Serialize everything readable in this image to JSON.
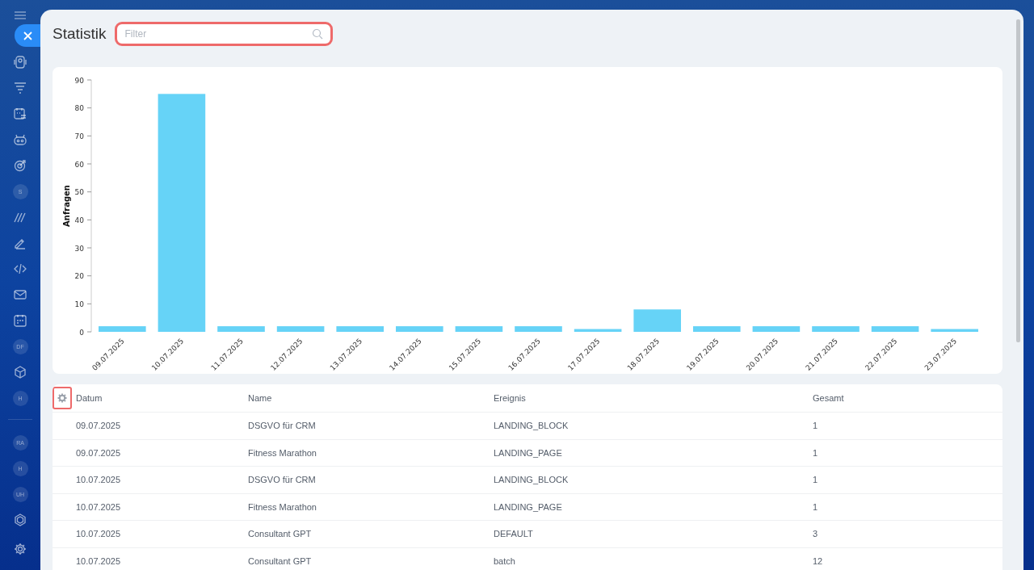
{
  "sidebar": {
    "items": [
      {
        "kind": "icon"
      },
      {
        "kind": "icon"
      },
      {
        "kind": "icon"
      },
      {
        "kind": "icon"
      },
      {
        "kind": "icon"
      },
      {
        "kind": "avatar",
        "label": "S"
      },
      {
        "kind": "icon"
      },
      {
        "kind": "icon"
      },
      {
        "kind": "icon"
      },
      {
        "kind": "icon"
      },
      {
        "kind": "icon"
      },
      {
        "kind": "avatar",
        "label": "DF"
      },
      {
        "kind": "icon"
      },
      {
        "kind": "avatar",
        "label": "H"
      },
      {
        "kind": "divider"
      },
      {
        "kind": "avatar",
        "label": "RA"
      },
      {
        "kind": "avatar",
        "label": "H"
      },
      {
        "kind": "avatar",
        "label": "UH"
      },
      {
        "kind": "icon"
      }
    ]
  },
  "page": {
    "title": "Statistik",
    "filter": {
      "placeholder": "Filter"
    }
  },
  "chart": {
    "chart_data": {
      "type": "bar",
      "ylabel": "Anfragen",
      "categories": [
        "09.07.2025",
        "10.07.2025",
        "11.07.2025",
        "12.07.2025",
        "13.07.2025",
        "14.07.2025",
        "15.07.2025",
        "16.07.2025",
        "17.07.2025",
        "18.07.2025",
        "19.07.2025",
        "20.07.2025",
        "21.07.2025",
        "22.07.2025",
        "23.07.2025"
      ],
      "series": [
        {
          "color": "#66d3f7",
          "values": [
            2,
            85,
            2,
            2,
            2,
            2,
            2,
            2,
            1,
            8,
            2,
            2,
            2,
            2,
            1
          ]
        }
      ],
      "ylim": [
        0,
        90
      ],
      "yticks": [
        0,
        10,
        20,
        30,
        40,
        50,
        60,
        70,
        80,
        90
      ]
    }
  },
  "table": {
    "columns": [
      "Datum",
      "Name",
      "Ereignis",
      "Gesamt"
    ],
    "rows": [
      [
        "09.07.2025",
        "DSGVO für CRM",
        "LANDING_BLOCK",
        "1"
      ],
      [
        "09.07.2025",
        "Fitness Marathon",
        "LANDING_PAGE",
        "1"
      ],
      [
        "10.07.2025",
        "DSGVO für CRM",
        "LANDING_BLOCK",
        "1"
      ],
      [
        "10.07.2025",
        "Fitness Marathon",
        "LANDING_PAGE",
        "1"
      ],
      [
        "10.07.2025",
        "Consultant GPT",
        "DEFAULT",
        "3"
      ],
      [
        "10.07.2025",
        "Consultant GPT",
        "batch",
        "12"
      ]
    ]
  }
}
